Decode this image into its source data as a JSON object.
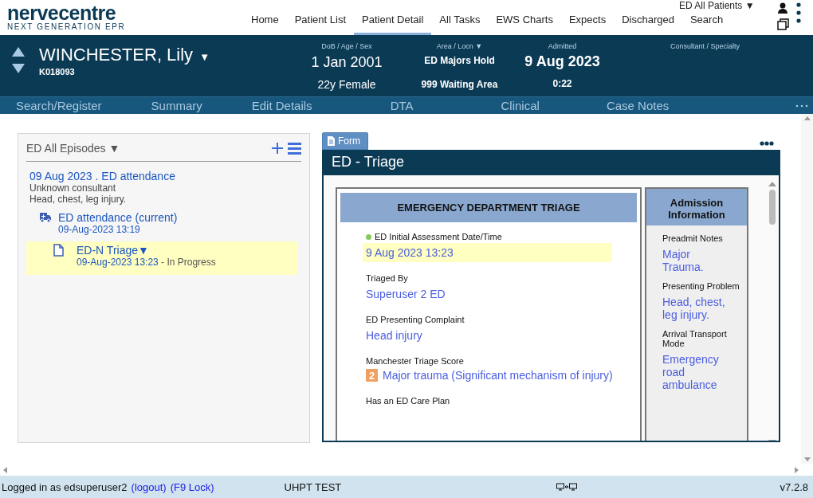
{
  "logo": {
    "name": "nervecentre",
    "tagline": "NEXT GENERATION EPR"
  },
  "nav": [
    {
      "label": "Home",
      "selected": false
    },
    {
      "label": "Patient List",
      "selected": false
    },
    {
      "label": "Patient Detail",
      "selected": true
    },
    {
      "label": "All Tasks",
      "selected": false
    },
    {
      "label": "EWS Charts",
      "selected": false
    },
    {
      "label": "Expects",
      "selected": false
    },
    {
      "label": "Discharged",
      "selected": false
    },
    {
      "label": "Search",
      "selected": false
    }
  ],
  "list_selector": {
    "label": "ED All Patients",
    "caret": "▼"
  },
  "patient": {
    "name": "WINCHESTER, Lily",
    "caret": "▼",
    "id": "K018093",
    "fields": [
      {
        "kind": "date",
        "label": "DoB / Age / Sex",
        "values": [
          "1 Jan 2001",
          "22y Female"
        ]
      },
      {
        "kind": "location",
        "label": "Area / Locn",
        "caret": "▼",
        "values": [
          "ED Majors Hold",
          "999 Waiting Area"
        ]
      },
      {
        "kind": "admitted",
        "label": "Admitted",
        "values": [
          "9 Aug 2023",
          "0:22"
        ]
      },
      {
        "kind": "empty",
        "label": "Consultant / Specialty"
      }
    ]
  },
  "subnav": [
    "Search/Register",
    "Summary",
    "Edit Details",
    "DTA",
    "Clinical",
    "Case Notes"
  ],
  "episodes": {
    "title": "ED All Episodes",
    "caret": "▼",
    "episode": {
      "title": "09 Aug 2023 . ED attendance",
      "consultant": "Unknown consultant",
      "complaint": "Head, chest, leg injury.",
      "children": [
        {
          "kind": "attendance",
          "title": "ED attendance (current)",
          "time": "09-Aug-2023 13:19",
          "selected": false,
          "children": [
            {
              "kind": "form",
              "title": "ED-N Triage",
              "caret": "▼",
              "time": "09-Aug-2023 13:23",
              "status": " - In Progress",
              "selected": true
            }
          ]
        }
      ]
    }
  },
  "form": {
    "tab": "Form",
    "title": "ED - Triage",
    "heading": "EMERGENCY DEPARTMENT TRIAGE",
    "fields": [
      {
        "label": "ED Initial Assessment Date/Time",
        "value": "9 Aug 2023 13:23",
        "complete": true,
        "highlighted": true
      },
      {
        "label": "Triaged By",
        "value": "Superuser 2 ED",
        "complete": false,
        "highlighted": false
      },
      {
        "label": "ED Presenting Complaint",
        "value": "Head injury",
        "complete": false,
        "highlighted": false
      },
      {
        "label": "Manchester Triage Score",
        "value": "Major trauma (Significant mechanism of injury)",
        "badge": "2",
        "complete": false,
        "highlighted": false
      },
      {
        "label": "Has an ED Care Plan",
        "complete": false,
        "highlighted": false
      }
    ],
    "side_heading": "Admission Information",
    "side_items": [
      {
        "label": "Preadmit Notes",
        "value": "Major Trauma."
      },
      {
        "label": "Presenting Problem",
        "value": "Head, chest, leg injury."
      },
      {
        "label": "Arrival Transport Mode",
        "value": "Emergency road ambulance"
      }
    ]
  },
  "status_bar": {
    "user": "Logged in as edsuperuser2",
    "logout": "(logout)",
    "lock": "(F9 Lock)",
    "environment": "UHPT TEST",
    "version": "v7.2.8"
  }
}
